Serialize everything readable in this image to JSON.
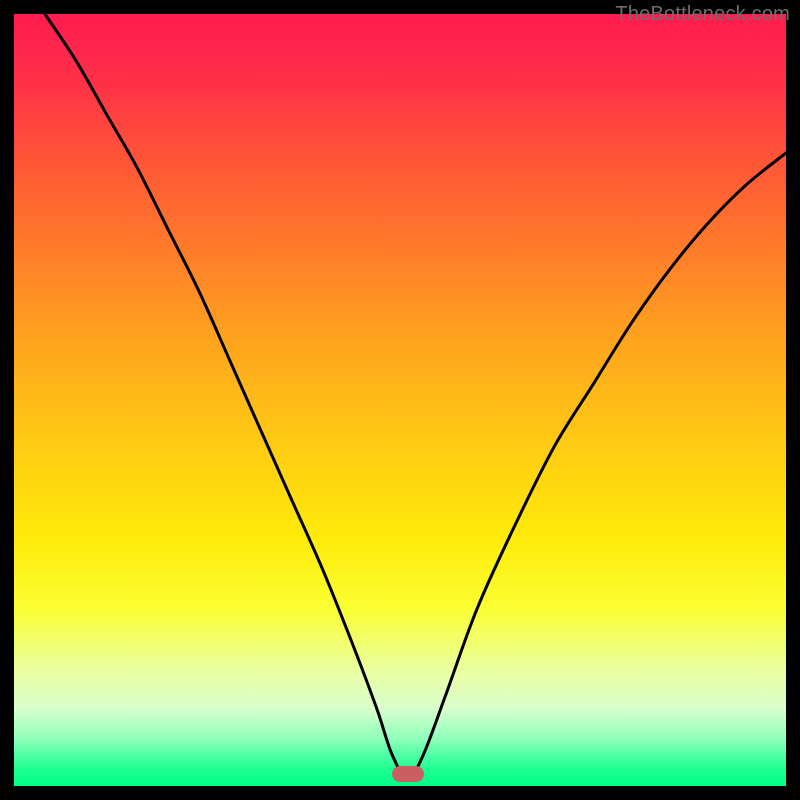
{
  "watermark": "TheBottleneck.com",
  "chart_data": {
    "type": "line",
    "title": "",
    "xlabel": "",
    "ylabel": "",
    "xlim": [
      0,
      100
    ],
    "ylim": [
      0,
      100
    ],
    "minimum_x": 51,
    "background_gradient": {
      "top": "#ff1b4e",
      "bottom": "#00ff88",
      "stops": [
        "red",
        "orange",
        "yellow",
        "green"
      ]
    },
    "marker": {
      "x": 51,
      "y": 1.5,
      "shape": "pill",
      "color": "#c96060"
    },
    "x": [
      4,
      8,
      12,
      16,
      20,
      24,
      28,
      32,
      36,
      40,
      44,
      47,
      49,
      51,
      53,
      56,
      60,
      65,
      70,
      75,
      80,
      85,
      90,
      95,
      100
    ],
    "values": [
      100,
      94,
      87,
      80,
      72,
      64,
      55,
      46,
      37,
      28,
      18,
      10,
      4,
      1,
      4,
      12,
      23,
      34,
      44,
      52,
      60,
      67,
      73,
      78,
      82
    ]
  }
}
